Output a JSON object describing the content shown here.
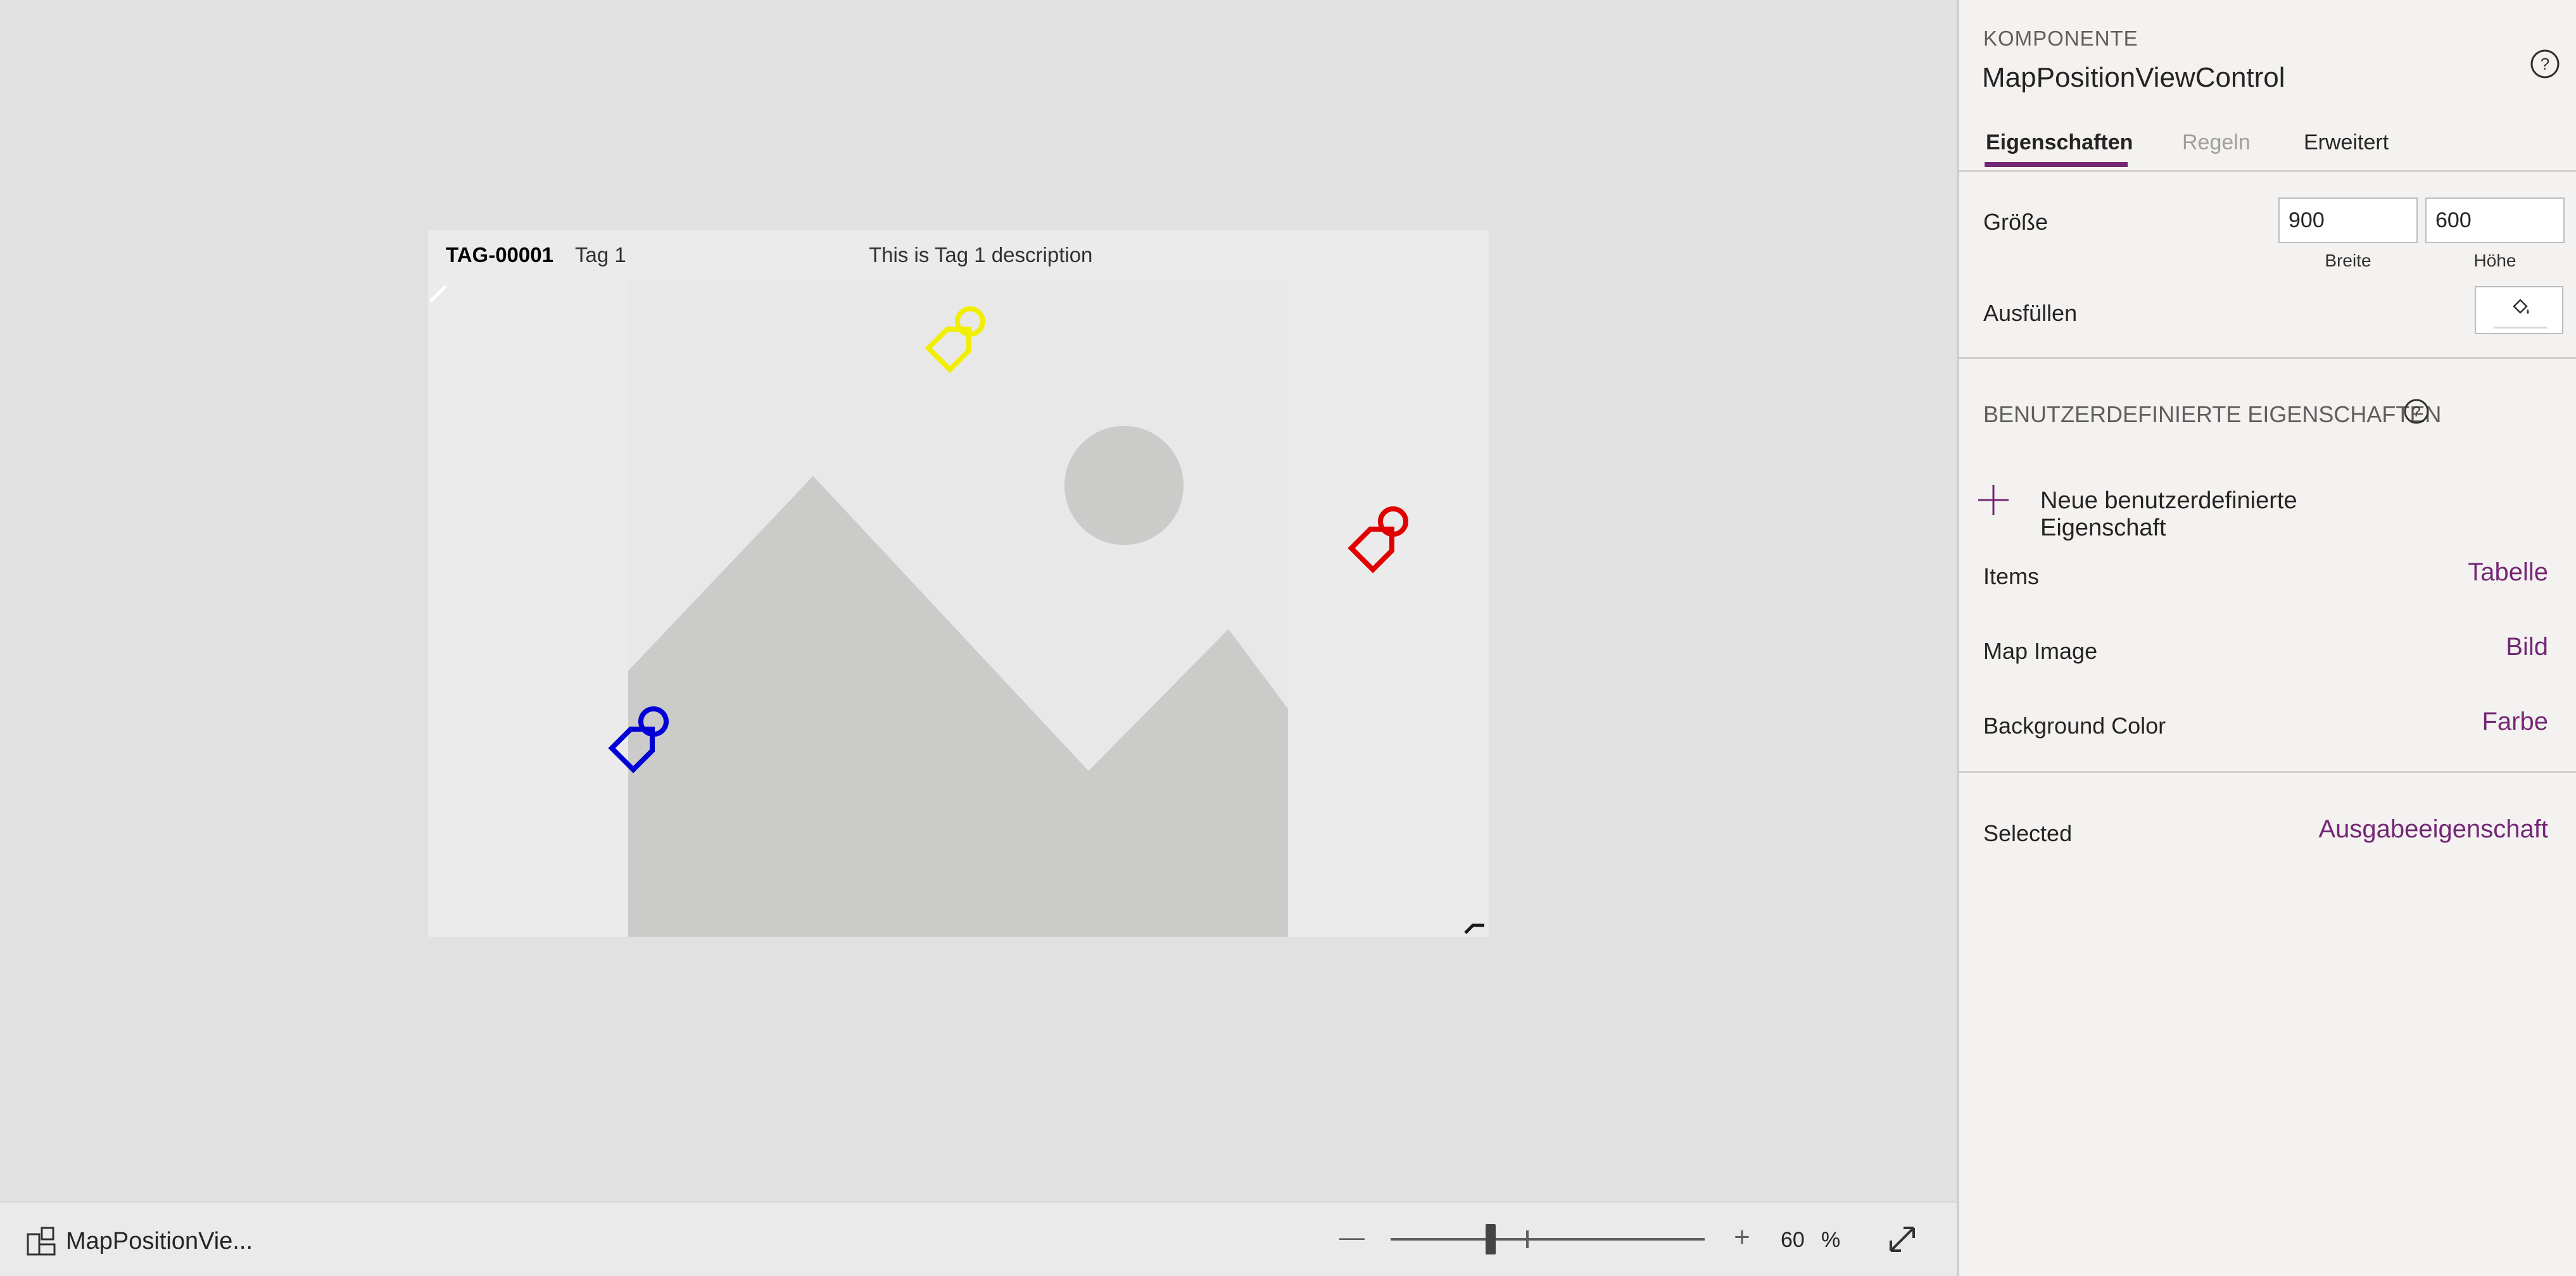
{
  "canvas": {
    "tag": {
      "id": "TAG-00001",
      "name": "Tag 1",
      "description": "This is Tag 1 description"
    },
    "markers": [
      {
        "name": "yellow",
        "color": "#f2ee00"
      },
      {
        "name": "red",
        "color": "#e00000"
      },
      {
        "name": "blue",
        "color": "#0000d6"
      }
    ],
    "image_placeholder_colors": {
      "background": "#e8e8e8",
      "shape": "#cbcbca"
    }
  },
  "status_bar": {
    "screen_name": "MapPositionVie...",
    "zoom_value": "60",
    "zoom_unit": "%",
    "zoom_out_symbol": "—",
    "zoom_in_symbol": "+"
  },
  "panel": {
    "kicker": "KOMPONENTE",
    "title": "MapPositionViewControl",
    "tabs": [
      {
        "label": "Eigenschaften",
        "state": "active"
      },
      {
        "label": "Regeln",
        "state": "disabled"
      },
      {
        "label": "Erweitert",
        "state": "normal"
      }
    ],
    "size": {
      "label": "Größe",
      "width_value": "900",
      "height_value": "600",
      "width_label": "Breite",
      "height_label": "Höhe"
    },
    "fill": {
      "label": "Ausfüllen"
    },
    "custom_heading": "BENUTZERDEFINIERTE EIGENSCHAFTEN",
    "add_custom_label": "Neue benutzerdefinierte Eigenschaft",
    "custom_properties": [
      {
        "name": "Items",
        "type": "Tabelle"
      },
      {
        "name": "Map Image",
        "type": "Bild"
      },
      {
        "name": "Background Color",
        "type": "Farbe"
      }
    ],
    "output_properties": [
      {
        "name": "Selected",
        "type": "Ausgabeeigenschaft"
      }
    ],
    "accent_color": "#742774"
  }
}
